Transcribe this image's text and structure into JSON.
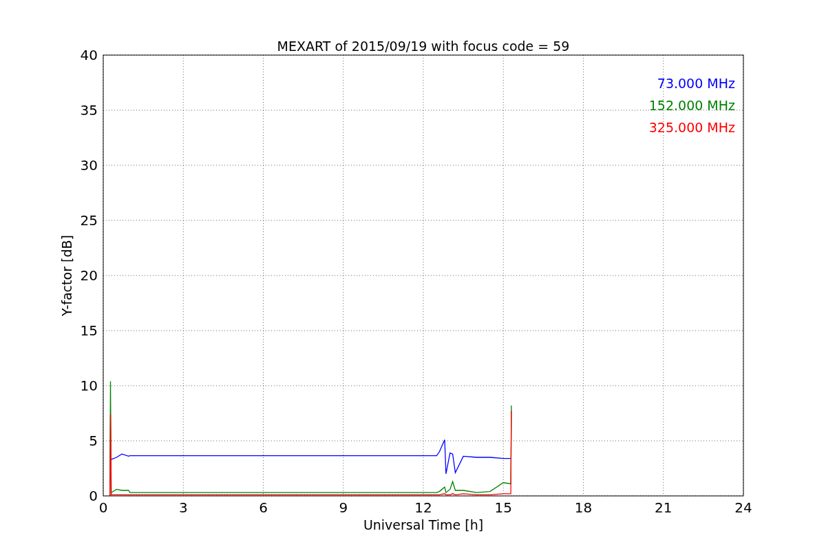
{
  "figure": {
    "chart_data": {
      "type": "line",
      "title": "MEXART of 2015/09/19 with focus code = 59",
      "xlabel": "Universal Time [h]",
      "ylabel": "Y-factor [dB]",
      "xlim": [
        0,
        24
      ],
      "ylim": [
        0,
        40
      ],
      "xticks": [
        0,
        3,
        6,
        9,
        12,
        15,
        18,
        21,
        24
      ],
      "yticks": [
        0,
        5,
        10,
        15,
        20,
        25,
        30,
        35,
        40
      ],
      "grid": true,
      "x": [
        0.25,
        0.27,
        0.3,
        0.5,
        0.7,
        0.95,
        1.0,
        12.5,
        12.6,
        12.8,
        12.85,
        13.0,
        13.1,
        13.2,
        13.5,
        14.0,
        14.5,
        15.0,
        15.28,
        15.3
      ],
      "series": [
        {
          "name": "73.000 MHz",
          "color": "#0000ff",
          "values": [
            null,
            3.6,
            3.3,
            3.5,
            3.8,
            3.6,
            3.65,
            3.65,
            4.0,
            5.1,
            2.0,
            3.9,
            3.8,
            2.1,
            3.6,
            3.5,
            3.5,
            3.4,
            3.4,
            null
          ]
        },
        {
          "name": "152.000 MHz",
          "color": "#008000",
          "values": [
            0,
            10.4,
            0.3,
            0.6,
            0.5,
            0.5,
            0.3,
            0.3,
            0.4,
            0.8,
            0.3,
            0.6,
            1.3,
            0.5,
            0.5,
            0.3,
            0.4,
            1.2,
            1.1,
            8.2
          ]
        },
        {
          "name": "325.000 MHz",
          "color": "#ff0000",
          "values": [
            0,
            7.4,
            0.1,
            0.1,
            0.1,
            0.1,
            0.1,
            0.1,
            0.1,
            0.2,
            0.1,
            0.1,
            0.2,
            0.1,
            0.2,
            0.1,
            0.1,
            0.2,
            0.2,
            7.7
          ]
        }
      ]
    }
  }
}
